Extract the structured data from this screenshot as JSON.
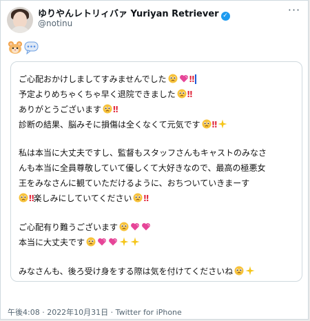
{
  "author": {
    "display_name": "ゆりやんレトリィバァ Yuriyan Retriever",
    "handle": "@notinu",
    "verified_color": "#1d9bf0"
  },
  "more_label": "···",
  "emoji_header": [
    "hamster-face",
    "speech-bubble"
  ],
  "tweet_lines": [
    "ご心配おかけしましてすみませんでした",
    "予定よりめちゃくちゃ早く退院できました",
    "ありがとうございます",
    "診断の結果、脳みそに損傷は全くなくて元気です",
    "私は本当に大丈夫ですし、監督もスタッフさんもキャストのみなさ",
    "んも本当に全員尊敬していて優しくて大好きなので、最高の極悪女",
    "王をみなさんに観ていただけるように、おちついていきまーす",
    "楽しみにしていてください",
    "ご心配有り難うございます",
    "本当に大丈夫です",
    "みなさんも、後ろ受け身をする際は気を付けてくださいね"
  ],
  "bang": "‼",
  "meta": "午後4:08 · 2022年10月31日 · Twitter for iPhone",
  "colors": {
    "bang": "#e0263a",
    "heart": "#e64598",
    "sparkle": "#f5c518",
    "pleading": "#f7c23a"
  }
}
